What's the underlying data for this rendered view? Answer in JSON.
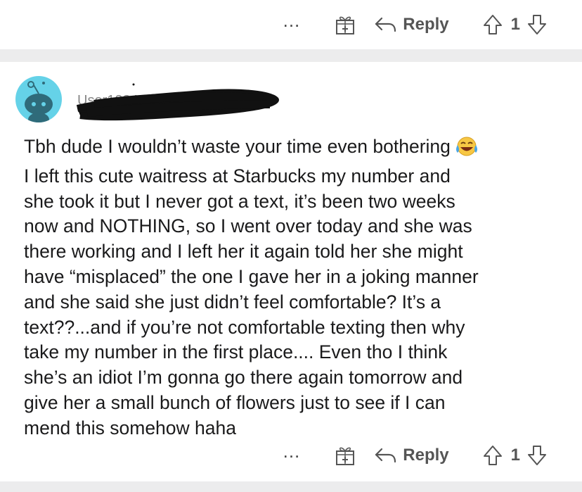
{
  "top_actions": {
    "more_label": "...",
    "award_icon": "gift-plus-icon",
    "reply_label": "Reply",
    "vote_count": "1"
  },
  "comment": {
    "username": "User1234 · 14h",
    "avatar_color": "#65d2e8",
    "body": "Tbh dude I wouldn’t waste your time even bothering I left this cute waitress at Starbucks my number and she took it but I never got a text, it’s been two weeks now and NOTHING, so I went over today and she was there working and I left her it again told her she might have “misplaced” the one I gave her in a joking manner and she said she just didn’t feel comfortable? It’s a text??...and if you’re not comfortable texting then why take my number in the first place.... Even tho I think she’s an idiot I’m gonna go there again tomorrow and give her a small bunch of flowers just to see if I can mend this somehow haha",
    "body_lines": [
      "Tbh dude I wouldn’t waste your time even bothering",
      "I left this cute waitress at Starbucks my number and",
      "she took it but I never got a text, it’s been two weeks",
      "now and NOTHING, so I went over today and she was",
      "there working and I left her it again told her she might",
      "have “misplaced” the one I gave her in a joking manner",
      "and she said she just didn’t feel comfortable? It’s a",
      "text??...and if you’re not comfortable texting then why",
      "take my number in the first place.... Even tho I think",
      "she’s an idiot I’m gonna go there again tomorrow and",
      "give her a small bunch of flowers just to see if I can",
      "mend this somehow haha"
    ],
    "emoji": "tears-of-joy-emoji"
  },
  "bottom_actions": {
    "more_label": "...",
    "award_icon": "gift-plus-icon",
    "reply_label": "Reply",
    "vote_count": "1"
  },
  "colors": {
    "divider": "#ececed",
    "action_text": "#555555",
    "body_text": "#1a1a1b"
  }
}
